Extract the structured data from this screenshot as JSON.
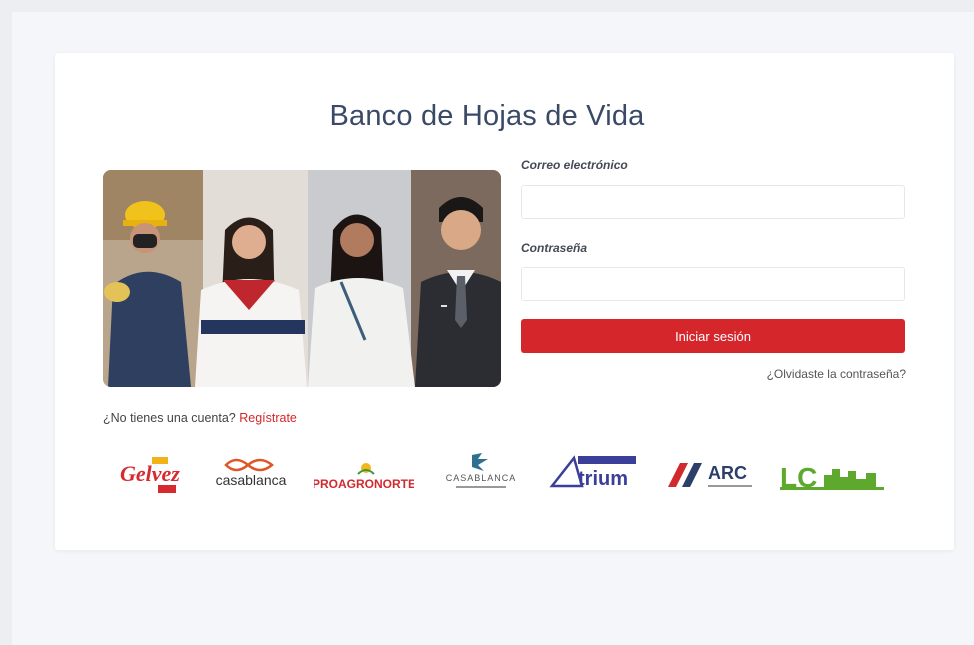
{
  "title": "Banco de Hojas de Vida",
  "login": {
    "email_label": "Correo electrónico",
    "email_value": "",
    "password_label": "Contraseña",
    "password_value": "",
    "submit_label": "Iniciar sesión",
    "forgot_label": "¿Olvidaste la contraseña?"
  },
  "signup": {
    "prompt": "¿No tienes una cuenta?",
    "link_label": "Regístrate"
  },
  "logos": [
    {
      "name": "Gelvez",
      "text": "Gelvez"
    },
    {
      "name": "casablanca",
      "text": "casablanca"
    },
    {
      "name": "Pronorte",
      "text": "PROAGRONORTE"
    },
    {
      "name": "Casablanca Hotel",
      "text": "CASABLANCA"
    },
    {
      "name": "Atrium",
      "text": "trium"
    },
    {
      "name": "ARC",
      "text": "ARC"
    },
    {
      "name": "LC",
      "text": "LC"
    }
  ],
  "colors": {
    "accent": "#d5262c",
    "title": "#3a4a66",
    "background": "#f4f6f9"
  }
}
